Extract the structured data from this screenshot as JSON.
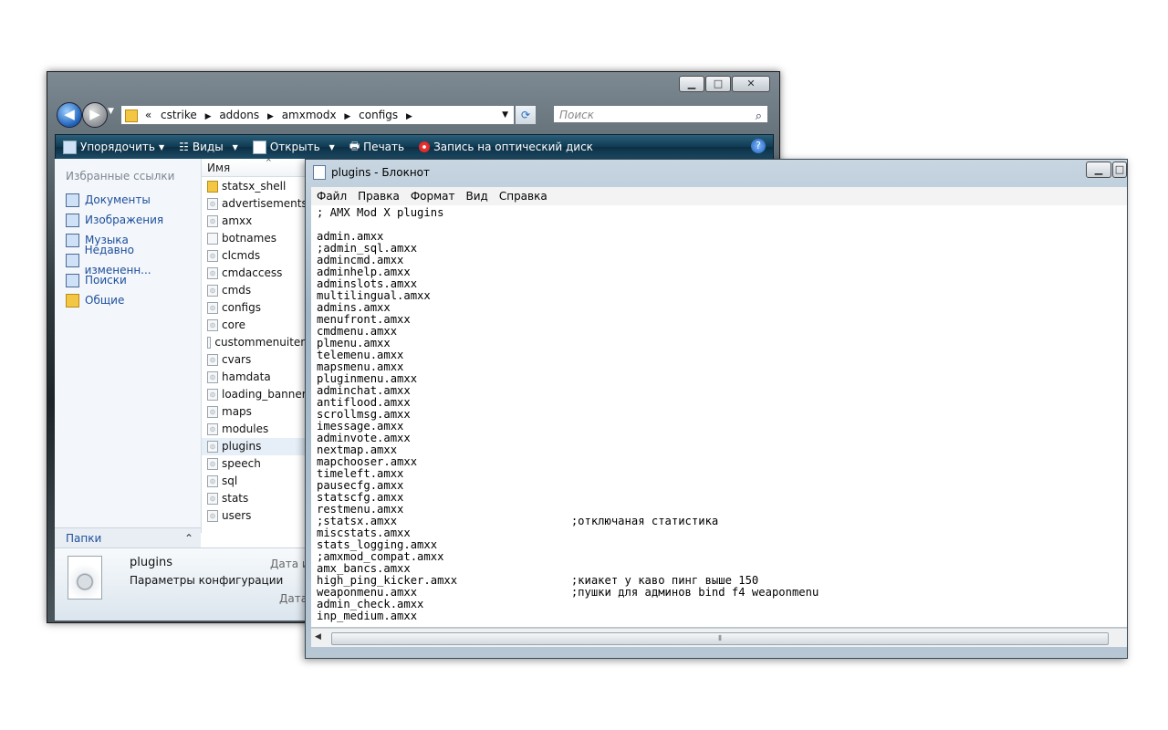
{
  "explorer": {
    "address": {
      "overflow": "«",
      "crumbs": [
        "cstrike",
        "addons",
        "amxmodx",
        "configs"
      ]
    },
    "search_placeholder": "Поиск",
    "toolbar": {
      "organize": "Упорядочить",
      "views": "Виды",
      "open": "Открыть",
      "print": "Печать",
      "burn": "Запись на оптический диск"
    },
    "favorites": {
      "header": "Избранные ссылки",
      "items": [
        "Документы",
        "Изображения",
        "Музыка",
        "Недавно измененн...",
        "Поиски",
        "Общие"
      ]
    },
    "folders_label": "Папки",
    "column_name": "Имя",
    "files": [
      {
        "name": "statsx_shell",
        "type": "folder"
      },
      {
        "name": "advertisements",
        "type": "cfg"
      },
      {
        "name": "amxx",
        "type": "cfg"
      },
      {
        "name": "botnames",
        "type": "txt"
      },
      {
        "name": "clcmds",
        "type": "cfg"
      },
      {
        "name": "cmdaccess",
        "type": "cfg"
      },
      {
        "name": "cmds",
        "type": "cfg"
      },
      {
        "name": "configs",
        "type": "cfg"
      },
      {
        "name": "core",
        "type": "cfg"
      },
      {
        "name": "custommenuitem",
        "type": "txt"
      },
      {
        "name": "cvars",
        "type": "cfg"
      },
      {
        "name": "hamdata",
        "type": "cfg"
      },
      {
        "name": "loading_banner",
        "type": "cfg"
      },
      {
        "name": "maps",
        "type": "cfg"
      },
      {
        "name": "modules",
        "type": "cfg"
      },
      {
        "name": "plugins",
        "type": "cfg"
      },
      {
        "name": "speech",
        "type": "cfg"
      },
      {
        "name": "sql",
        "type": "cfg"
      },
      {
        "name": "stats",
        "type": "cfg"
      },
      {
        "name": "users",
        "type": "cfg"
      }
    ],
    "selected_file": "plugins",
    "details": {
      "name": "plugins",
      "type": "Параметры конфигурации",
      "label_modified": "Дата из",
      "label_created": "Дата с"
    }
  },
  "notepad": {
    "title": "plugins - Блокнот",
    "menu": [
      "Файл",
      "Правка",
      "Формат",
      "Вид",
      "Справка"
    ],
    "content": "; AMX Mod X plugins\n\nadmin.amxx\n;admin_sql.amxx\nadmincmd.amxx\nadminhelp.amxx\nadminslots.amxx\nmultilingual.amxx\nadmins.amxx\nmenufront.amxx\ncmdmenu.amxx\nplmenu.amxx\ntelemenu.amxx\nmapsmenu.amxx\npluginmenu.amxx\nadminchat.amxx\nantiflood.amxx\nscrollmsg.amxx\nimessage.amxx\nadminvote.amxx\nnextmap.amxx\nmapchooser.amxx\ntimeleft.amxx\npausecfg.amxx\nstatscfg.amxx\nrestmenu.amxx\n;statsx.amxx                          ;отключаная статистика\nmiscstats.amxx\nstats_logging.amxx\n;amxmod_compat.amxx\namx_bancs.amxx\nhigh_ping_kicker.amxx                 ;киакет у каво пинг выше 150\nweaponmenu.amxx                       ;пушки для админов bind f4 weaponmenu\nadmin_check.amxx\ninp_medium.amxx"
  }
}
